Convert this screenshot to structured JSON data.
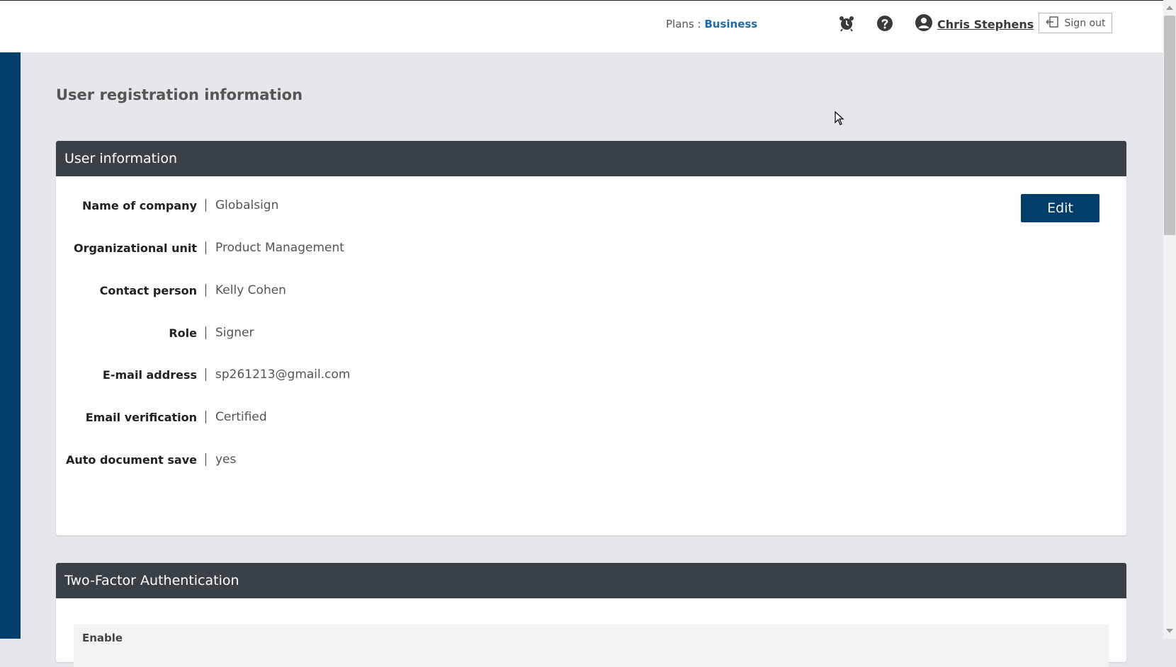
{
  "header": {
    "plans_label": "Plans :",
    "plan_value": "Business",
    "user_name": "Chris Stephens",
    "signout_label": "Sign out",
    "icons": [
      "alarm-clock-icon",
      "help-icon",
      "user-icon",
      "sign-out-icon"
    ]
  },
  "page": {
    "title": "User registration information"
  },
  "user_info": {
    "header": "User information",
    "edit_label": "Edit",
    "rows": [
      {
        "label": "Name of company",
        "value": "Globalsign"
      },
      {
        "label": "Organizational unit",
        "value": "Product Management"
      },
      {
        "label": "Contact person",
        "value": "Kelly Cohen"
      },
      {
        "label": "Role",
        "value": "Signer"
      },
      {
        "label": "E-mail address",
        "value": "sp261213@gmail.com"
      },
      {
        "label": "Email verification",
        "value": "Certified"
      },
      {
        "label": "Auto document save",
        "value": "yes"
      }
    ]
  },
  "two_factor": {
    "header": "Two-Factor Authentication",
    "enable_label": "Enable"
  },
  "colors": {
    "brand_dark_blue": "#003e6c",
    "panel_header": "#3a4146",
    "plan_link": "#1e6aa8"
  }
}
